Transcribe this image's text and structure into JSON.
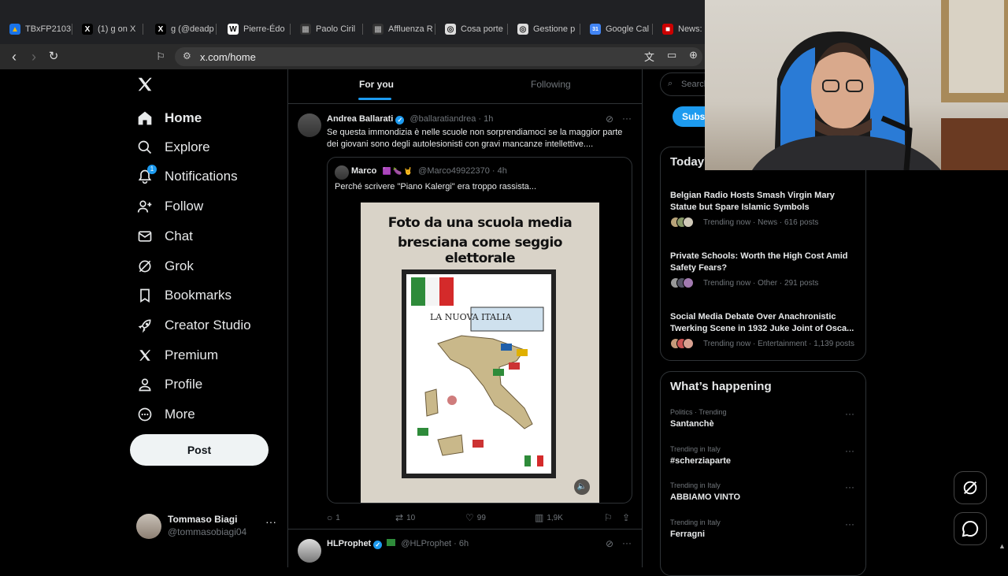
{
  "browser": {
    "tabs": [
      {
        "label": "TBxFP2103",
        "fav_color": "#1a73e8",
        "fav_glyph": "▲"
      },
      {
        "label": "(1) g on X",
        "fav_color": "#000000",
        "fav_glyph": "X"
      },
      {
        "label": "g (@deadp",
        "fav_color": "#000000",
        "fav_glyph": "X"
      },
      {
        "label": "Pierre-Édo",
        "fav_color": "#ffffff",
        "fav_glyph": "W"
      },
      {
        "label": "Paolo Ciril",
        "fav_color": "#333333",
        "fav_glyph": "▦"
      },
      {
        "label": "Affluenza R",
        "fav_color": "#333333",
        "fav_glyph": "▦"
      },
      {
        "label": "Cosa porte",
        "fav_color": "#dddddd",
        "fav_glyph": "◎"
      },
      {
        "label": "Gestione p",
        "fav_color": "#dddddd",
        "fav_glyph": "◎"
      },
      {
        "label": "Google Cal",
        "fav_color": "#4285f4",
        "fav_glyph": "31"
      },
      {
        "label": "News: u",
        "fav_color": "#cc0000",
        "fav_glyph": "■"
      }
    ],
    "url": "x.com/home"
  },
  "nav": {
    "items": [
      {
        "label": "Home",
        "icon": "home-icon"
      },
      {
        "label": "Explore",
        "icon": "search-icon"
      },
      {
        "label": "Notifications",
        "icon": "bell-icon",
        "badge": "1"
      },
      {
        "label": "Follow",
        "icon": "follow-icon"
      },
      {
        "label": "Chat",
        "icon": "mail-icon"
      },
      {
        "label": "Grok",
        "icon": "grok-icon"
      },
      {
        "label": "Bookmarks",
        "icon": "bookmark-icon"
      },
      {
        "label": "Creator Studio",
        "icon": "rocket-icon"
      },
      {
        "label": "Premium",
        "icon": "x-logo-icon"
      },
      {
        "label": "Profile",
        "icon": "profile-icon"
      },
      {
        "label": "More",
        "icon": "more-circle-icon"
      }
    ],
    "post_label": "Post",
    "account": {
      "name": "Tommaso Biagi",
      "handle": "@tommasobiagi04"
    }
  },
  "feed": {
    "tabs": {
      "foryou": "For you",
      "following": "Following"
    },
    "tweet1": {
      "name": "Andrea Ballarati",
      "handle": "@ballaratiandrea · 1h",
      "text": "Se questa immondizia è nelle scuole non sorprendiamoci se la maggior parte dei giovani sono degli autolesionisti con gravi mancanze intellettive....",
      "quote": {
        "name": "Marco",
        "emojis": "🟪 🍆 🤘",
        "handle": "@Marco49922370 · 4h",
        "text": "Perché scrivere \"Piano Kalergi\" era troppo rassista...",
        "image_title_1": "Foto da una scuola media",
        "image_title_2": "bresciana come seggio elettorale",
        "poster_heading": "LA NUOVA ITALIA"
      },
      "replies": "1",
      "reposts": "10",
      "likes": "99",
      "views": "1,9K"
    },
    "tweet2": {
      "name": "HLProphet",
      "handle": "@HLProphet · 6h"
    }
  },
  "right": {
    "search_placeholder": "Search",
    "subscribe_label": "Subscribe",
    "today_title": "Today's News",
    "news": [
      {
        "title": "Belgian Radio Hosts Smash Virgin Mary Statue but Spare Islamic Symbols",
        "meta": "Trending now · News · 616 posts"
      },
      {
        "title": "Private Schools: Worth the High Cost Amid Safety Fears?",
        "meta": "Trending now · Other · 291 posts"
      },
      {
        "title": "Social Media Debate Over Anachronistic Twerking Scene in 1932 Juke Joint of Osca...",
        "meta": "Trending now · Entertainment · 1,139 posts"
      }
    ],
    "whats_title": "What’s happening",
    "trends": [
      {
        "category": "Politics · Trending",
        "name": "Santanchè"
      },
      {
        "category": "Trending in Italy",
        "name": "#scherziaparte"
      },
      {
        "category": "Trending in Italy",
        "name": "ABBIAMO VINTO"
      },
      {
        "category": "Trending in Italy",
        "name": "Ferragni"
      }
    ]
  },
  "colors": {
    "accent": "#1d9bf0",
    "background": "#000000",
    "border": "#2f3336"
  }
}
